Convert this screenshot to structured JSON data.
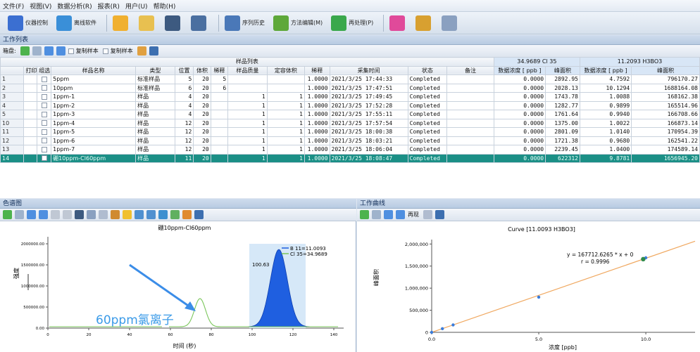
{
  "menu": [
    "文件(F)",
    "视图(V)",
    "数据分析(R)",
    "报表(R)",
    "用户(U)",
    "帮助(H)"
  ],
  "toolbar": {
    "items": [
      {
        "label": "仪器控制",
        "icon": "instrument-icon",
        "color": "#3b6fd1"
      },
      {
        "label": "离线软件",
        "icon": "offline-icon",
        "color": "#3a8fd8"
      },
      {
        "label": "",
        "icon": "open-icon",
        "color": "#f0b030"
      },
      {
        "label": "",
        "icon": "folder-icon",
        "color": "#e8c050"
      },
      {
        "label": "",
        "icon": "save-icon",
        "color": "#3d5a80"
      },
      {
        "label": "",
        "icon": "save-as-icon",
        "color": "#4a6fa0"
      },
      {
        "label": "序列历史",
        "icon": "sequence-history-icon",
        "color": "#4a78b8"
      },
      {
        "label": "方法编辑(M)",
        "icon": "method-edit-icon",
        "color": "#5ea83a"
      },
      {
        "label": "再处理(P)",
        "icon": "reprocess-icon",
        "color": "#3aa84c"
      },
      {
        "label": "",
        "icon": "report-icon",
        "color": "#e04a9a"
      },
      {
        "label": "",
        "icon": "users-icon",
        "color": "#d8a030"
      },
      {
        "label": "",
        "icon": "window-icon",
        "color": "#8aa0c0"
      }
    ]
  },
  "worklist": {
    "title": "工作列表",
    "subbar": [
      "箱盘:",
      "复制样本",
      "复制样本"
    ],
    "group_header": "样品列表",
    "group2": "34.9689  Cl 35",
    "group3": "11.2093  H3BO3",
    "columns": [
      "",
      "打印",
      "组选",
      "样品名称",
      "类型",
      "位置",
      "体积",
      "稀释",
      "样品质量",
      "定容体积",
      "稀释",
      "采集时间",
      "状态",
      "备注",
      "数据浓度 [ ppb ]",
      "峰面积",
      "数据浓度 [ ppb ]",
      "峰面积"
    ],
    "rows": [
      {
        "n": "1",
        "name": "5ppm",
        "type": "标准样品",
        "pos": "5",
        "vol": "20",
        "dil": "5",
        "mass": "",
        "cvol": "",
        "d2": "1.0000",
        "time": "2021/3/25 17:44:33",
        "status": "Completed",
        "note": "",
        "c1": "0.0000",
        "a1": "2892.95",
        "c2": "4.7592",
        "a2": "796170.27"
      },
      {
        "n": "2",
        "name": "10ppm",
        "type": "标准样品",
        "pos": "6",
        "vol": "20",
        "dil": "6",
        "mass": "",
        "cvol": "",
        "d2": "1.0000",
        "time": "2021/3/25 17:47:51",
        "status": "Completed",
        "note": "",
        "c1": "0.0000",
        "a1": "2028.13",
        "c2": "10.1294",
        "a2": "1688164.08"
      },
      {
        "n": "3",
        "name": "1ppm-1",
        "type": "样品",
        "pos": "4",
        "vol": "20",
        "dil": "",
        "mass": "1",
        "cvol": "1",
        "d2": "1.0000",
        "time": "2021/3/25 17:49:45",
        "status": "Completed",
        "note": "",
        "c1": "0.0000",
        "a1": "1743.78",
        "c2": "1.0088",
        "a2": "168162.38"
      },
      {
        "n": "4",
        "name": "1ppm-2",
        "type": "样品",
        "pos": "4",
        "vol": "20",
        "dil": "",
        "mass": "1",
        "cvol": "1",
        "d2": "1.0000",
        "time": "2021/3/25 17:52:28",
        "status": "Completed",
        "note": "",
        "c1": "0.0000",
        "a1": "1282.77",
        "c2": "0.9899",
        "a2": "165514.96"
      },
      {
        "n": "5",
        "name": "1ppm-3",
        "type": "样品",
        "pos": "4",
        "vol": "20",
        "dil": "",
        "mass": "1",
        "cvol": "1",
        "d2": "1.0000",
        "time": "2021/3/25 17:55:11",
        "status": "Completed",
        "note": "",
        "c1": "0.0000",
        "a1": "1761.64",
        "c2": "0.9940",
        "a2": "166708.66"
      },
      {
        "n": "10",
        "name": "1ppm-4",
        "type": "样品",
        "pos": "12",
        "vol": "20",
        "dil": "",
        "mass": "1",
        "cvol": "1",
        "d2": "1.0000",
        "time": "2021/3/25 17:57:54",
        "status": "Completed",
        "note": "",
        "c1": "0.0000",
        "a1": "1375.00",
        "c2": "1.0022",
        "a2": "166873.14"
      },
      {
        "n": "11",
        "name": "1ppm-5",
        "type": "样品",
        "pos": "12",
        "vol": "20",
        "dil": "",
        "mass": "1",
        "cvol": "1",
        "d2": "1.0000",
        "time": "2021/3/25 18:00:38",
        "status": "Completed",
        "note": "",
        "c1": "0.0000",
        "a1": "2801.09",
        "c2": "1.0140",
        "a2": "170954.39"
      },
      {
        "n": "12",
        "name": "1ppm-6",
        "type": "样品",
        "pos": "12",
        "vol": "20",
        "dil": "",
        "mass": "1",
        "cvol": "1",
        "d2": "1.0000",
        "time": "2021/3/25 18:03:21",
        "status": "Completed",
        "note": "",
        "c1": "0.0000",
        "a1": "1721.38",
        "c2": "0.9680",
        "a2": "162541.22"
      },
      {
        "n": "13",
        "name": "1ppm-7",
        "type": "样品",
        "pos": "12",
        "vol": "20",
        "dil": "",
        "mass": "1",
        "cvol": "1",
        "d2": "1.0000",
        "time": "2021/3/25 18:06:04",
        "status": "Completed",
        "note": "",
        "c1": "0.0000",
        "a1": "2239.45",
        "c2": "1.0400",
        "a2": "174589.14"
      },
      {
        "n": "14",
        "name": "硼10ppm-Cl60ppm",
        "type": "样品",
        "pos": "11",
        "vol": "20",
        "dil": "",
        "mass": "1",
        "cvol": "1",
        "d2": "1.0000",
        "time": "2021/3/25 18:08:47",
        "status": "Completed",
        "note": "",
        "c1": "0.0000",
        "a1": "622312",
        "c2": "9.8781",
        "a2": "1656945.20",
        "selected": true
      }
    ]
  },
  "chromatogram": {
    "title": "色谱图",
    "plot_title": "硼10ppm-Cl60ppm",
    "legend": [
      "B 11=11.0093",
      "Cl 35=34.9689"
    ],
    "peak_label": "100.63",
    "annotation": "60ppm氯离子",
    "xlabel": "时间 (秒)",
    "ylabel": "强度",
    "ytick_labels": [
      "2000000.00",
      "1500000.00",
      "1000000.00",
      "500000.00",
      "0.00"
    ],
    "xtick_labels": [
      "0",
      "20",
      "40",
      "60",
      "80",
      "100",
      "120",
      "140"
    ],
    "colors": {
      "b11": "#1f5fe0",
      "cl35": "#7ac65a",
      "arrow": "#3b8de8",
      "annot": "#3b9be8"
    }
  },
  "calibration": {
    "title": "工作曲线",
    "subbar": "再现",
    "curve_title": "Curve [11.0093 H3BO3]",
    "equation": "y = 167712.6265 * x + 0",
    "r": "r = 0.9996",
    "xlabel": "浓度 [ppb]",
    "ylabel": "峰面积",
    "colors": {
      "line": "#f0a860",
      "point": "#3b7ddb",
      "sample": "#2e8a4a"
    }
  },
  "chart_data": {
    "type": "scatter",
    "title": "Curve [11.0093 H3BO3]",
    "xlabel": "浓度 [ppb]",
    "ylabel": "峰面积",
    "x_ticks": [
      "0.0",
      "5.0",
      "10.0"
    ],
    "y_ticks": [
      "0",
      "500,000",
      "1,000,000",
      "1,500,000",
      "2,000,000"
    ],
    "xlim": [
      0,
      12.3
    ],
    "ylim": [
      0,
      2100000
    ],
    "series": [
      {
        "name": "standards",
        "x": [
          0,
          0.5,
          1.0,
          5.0,
          10.0
        ],
        "y": [
          0,
          83000,
          167000,
          796170,
          1688164
        ]
      },
      {
        "name": "sample",
        "x": [
          9.8781
        ],
        "y": [
          1656945
        ]
      }
    ],
    "line": {
      "slope": 167712.6265,
      "intercept": 0
    }
  }
}
